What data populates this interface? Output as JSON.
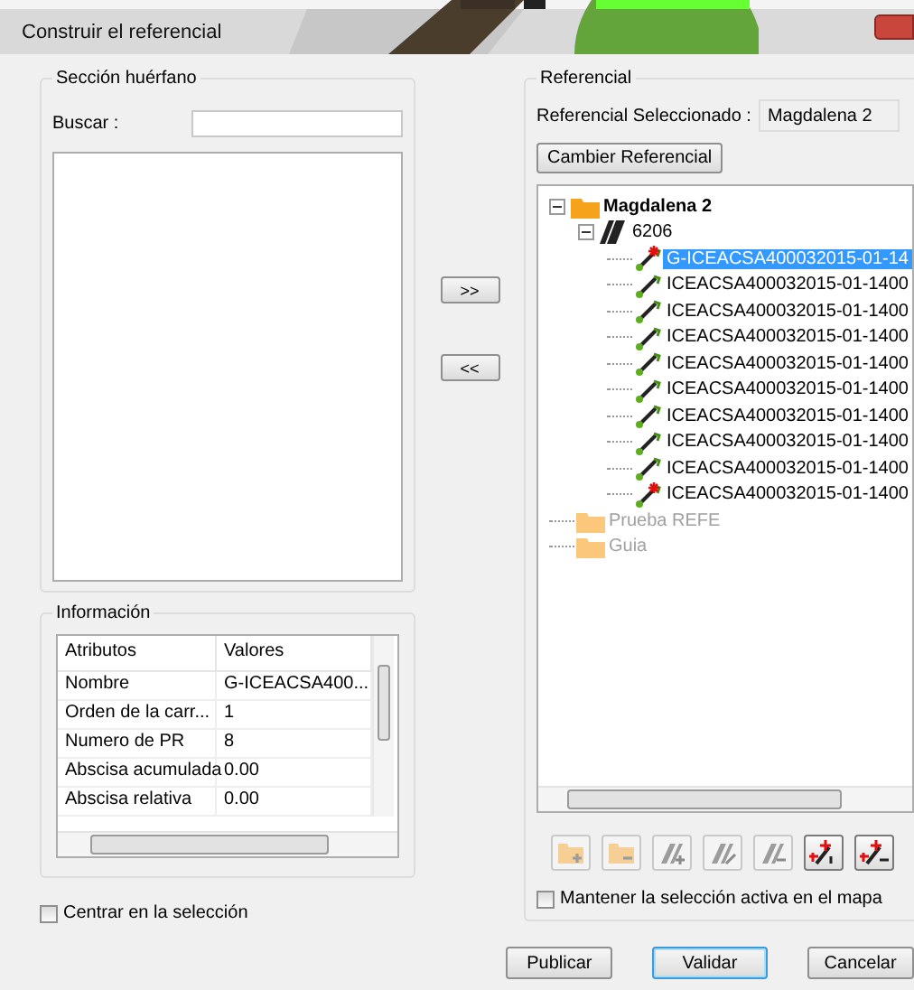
{
  "window": {
    "title": "Construir el referencial"
  },
  "orphan_section": {
    "title": "Sección huérfano",
    "search_label": "Buscar :"
  },
  "move_buttons": [
    ">>",
    "<<"
  ],
  "info": {
    "title": "Información",
    "columns": [
      "Atributos",
      "Valores"
    ],
    "rows": [
      {
        "attribute": "Nombre",
        "value": "G-ICEACSA400..."
      },
      {
        "attribute": "Orden de la carr...",
        "value": "1"
      },
      {
        "attribute": "Numero de PR",
        "value": "8"
      },
      {
        "attribute": "Abscisa acumulada",
        "value": "0.00"
      },
      {
        "attribute": "Abscisa relativa",
        "value": "0.00"
      }
    ]
  },
  "center_checkbox": {
    "label": "Centrar en la selección",
    "checked": false
  },
  "referencial": {
    "title": "Referencial",
    "selected_label": "Referencial Seleccionado :",
    "selected_value": "Magdalena 2",
    "change_button": "Cambier Referencial"
  },
  "tree": [
    {
      "kind": "folder",
      "label": "Magdalena 2",
      "expanded": true,
      "disabled": false,
      "children": [
        {
          "kind": "road",
          "label": "6206",
          "expanded": true,
          "children": [
            {
              "kind": "pr",
              "label": "G-ICEACSA400032015-01-14",
              "selected": true,
              "marked": true
            },
            {
              "kind": "pr",
              "label": "ICEACSA400032015-01-1400",
              "selected": false,
              "marked": false
            },
            {
              "kind": "pr",
              "label": "ICEACSA400032015-01-1400",
              "selected": false,
              "marked": false
            },
            {
              "kind": "pr",
              "label": "ICEACSA400032015-01-1400",
              "selected": false,
              "marked": false
            },
            {
              "kind": "pr",
              "label": "ICEACSA400032015-01-1400",
              "selected": false,
              "marked": false
            },
            {
              "kind": "pr",
              "label": "ICEACSA400032015-01-1400",
              "selected": false,
              "marked": false
            },
            {
              "kind": "pr",
              "label": "ICEACSA400032015-01-1400",
              "selected": false,
              "marked": false
            },
            {
              "kind": "pr",
              "label": "ICEACSA400032015-01-1400",
              "selected": false,
              "marked": false
            },
            {
              "kind": "pr",
              "label": "ICEACSA400032015-01-1400",
              "selected": false,
              "marked": false
            },
            {
              "kind": "pr",
              "label": "ICEACSA400032015-01-1400",
              "selected": false,
              "marked": true
            }
          ]
        }
      ]
    },
    {
      "kind": "folder",
      "label": "Prueba REFE",
      "disabled": true
    },
    {
      "kind": "folder",
      "label": "Guia",
      "disabled": true
    }
  ],
  "toolbar": [
    {
      "kind": "folder-add",
      "disabled": true
    },
    {
      "kind": "folder-remove",
      "disabled": true
    },
    {
      "kind": "road-add",
      "disabled": true
    },
    {
      "kind": "road-edit",
      "disabled": true
    },
    {
      "kind": "road-remove",
      "disabled": true
    },
    {
      "kind": "pr-add",
      "disabled": false
    },
    {
      "kind": "pr-remove",
      "disabled": false
    }
  ],
  "keep_checkbox": {
    "label": "Mantener la selección activa en el mapa",
    "checked": false
  },
  "buttons": [
    {
      "label": "Publicar",
      "default": false
    },
    {
      "label": "Validar",
      "default": true
    },
    {
      "label": "Cancelar",
      "default": false
    }
  ]
}
